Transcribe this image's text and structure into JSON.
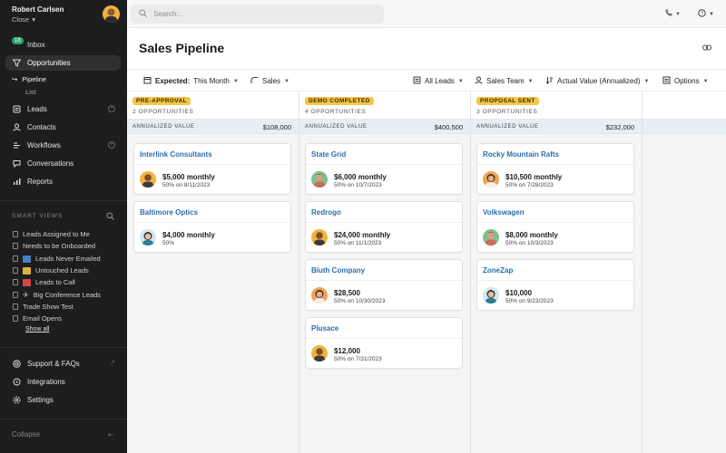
{
  "user": {
    "name": "Robert Carlsen",
    "org": "Close"
  },
  "sidebar": {
    "inbox_badge": "18",
    "items": [
      {
        "label": "Inbox"
      },
      {
        "label": "Opportunities"
      },
      {
        "label": "Leads"
      },
      {
        "label": "Contacts"
      },
      {
        "label": "Workflows"
      },
      {
        "label": "Conversations"
      },
      {
        "label": "Reports"
      }
    ],
    "sub": {
      "pipeline": "Pipeline",
      "list": "List"
    },
    "smart_views_title": "SMART VIEWS",
    "smart_views": [
      "Leads Assigned to Me",
      "Needs to be Onboarded",
      "Leads Never Emailed",
      "Untouched Leads",
      "Leads to Call",
      "Big Conference Leads",
      "Trade Show Test",
      "Email Opens"
    ],
    "show_all": "Show all",
    "bottom": [
      "Support & FAQs",
      "Integrations",
      "Settings"
    ],
    "collapse": "Collapse"
  },
  "search": {
    "placeholder": "Search..."
  },
  "page": {
    "title": "Sales Pipeline"
  },
  "filters": {
    "expected_label": "Expected:",
    "expected_value": "This Month",
    "pipeline": "Sales",
    "leads": "All Leads",
    "team": "Sales Team",
    "sort": "Actual Value (Annualized)",
    "options": "Options"
  },
  "columns": [
    {
      "stage": "PRE-APPROVAL",
      "count": "2 OPPORTUNITIES",
      "annual_label": "ANNUALIZED VALUE",
      "annual_value": "$108,000",
      "cards": [
        {
          "name": "Interlink Consultants",
          "amount": "$5,000 monthly",
          "sub": "50% on 8/11/2023"
        },
        {
          "name": "Baltimore Optics",
          "amount": "$4,000 monthly",
          "sub": "50%"
        }
      ]
    },
    {
      "stage": "DEMO COMPLETED",
      "count": "4 OPPORTUNITIES",
      "annual_label": "ANNUALIZED VALUE",
      "annual_value": "$400,500",
      "cards": [
        {
          "name": "State Grid",
          "amount": "$6,000 monthly",
          "sub": "50% on 10/7/2023"
        },
        {
          "name": "Redrogo",
          "amount": "$24,000 monthly",
          "sub": "50% on 11/1/2023"
        },
        {
          "name": "Bluth Company",
          "amount": "$28,500",
          "sub": "50% on 10/30/2023"
        },
        {
          "name": "Plusace",
          "amount": "$12,000",
          "sub": "50% on 7/31/2023"
        }
      ]
    },
    {
      "stage": "PROPOSAL SENT",
      "count": "3 OPPORTUNITIES",
      "annual_label": "ANNUALIZED VALUE",
      "annual_value": "$232,000",
      "cards": [
        {
          "name": "Rocky Mountain Rafts",
          "amount": "$10,500 monthly",
          "sub": "50% on 7/28/2023"
        },
        {
          "name": "Volkswagen",
          "amount": "$8,000 monthly",
          "sub": "50% on 10/3/2023"
        },
        {
          "name": "ZoneZap",
          "amount": "$10,000",
          "sub": "50% on 9/23/2023"
        }
      ]
    }
  ],
  "colors": {
    "stage_badge": "#f6c64a",
    "link": "#2a6fb0",
    "sidebar_bg": "#1d1d1d",
    "annual_bg": "#e6eef6"
  }
}
